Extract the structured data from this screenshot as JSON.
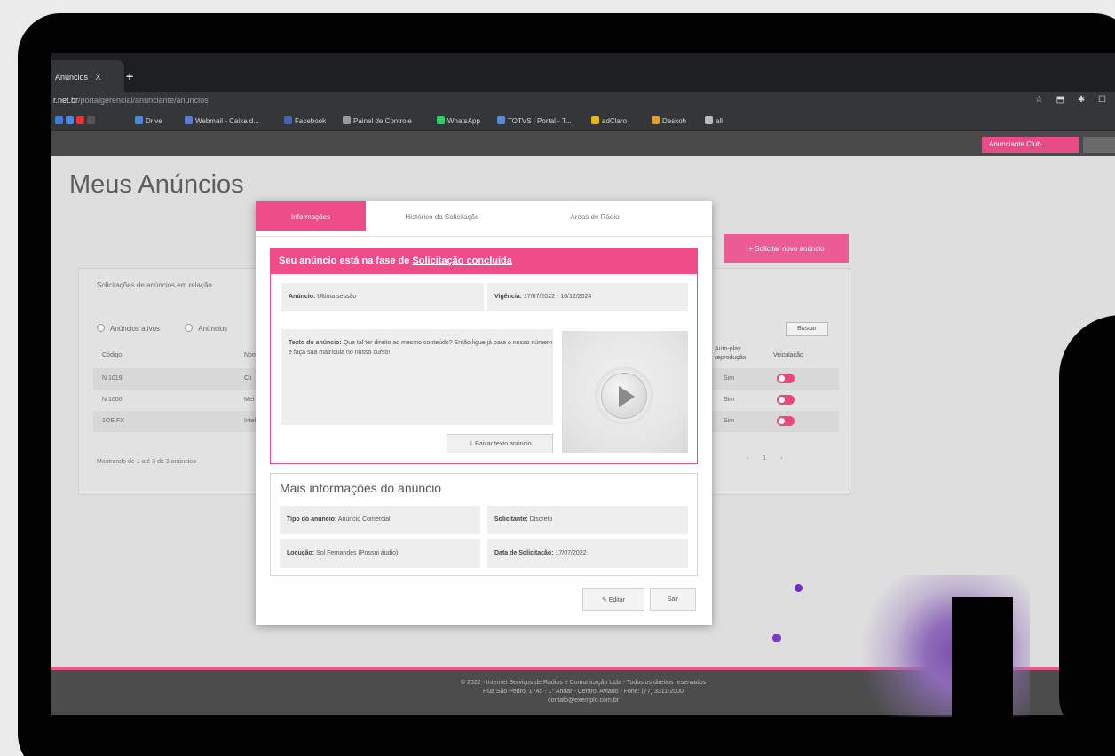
{
  "browser": {
    "tab_title": "Anúncios",
    "tab_close": "X",
    "new_tab": "+",
    "url_domain": "r.net.br",
    "url_path": "/portalgerencial/anunciante/anuncios",
    "url_actions": "☆ ⬒ ✱ ☐",
    "bookmarks": [
      {
        "label": "Drive",
        "color": "#4a88e8"
      },
      {
        "label": "Webmail - Caixa d...",
        "color": "#5b7bd6"
      },
      {
        "label": "Facebook",
        "color": "#4267b2"
      },
      {
        "label": "Painel de Controle",
        "color": "#999999"
      },
      {
        "label": "WhatsApp",
        "color": "#25d366"
      },
      {
        "label": "TOTVS | Portal - T...",
        "color": "#5a8ad6"
      },
      {
        "label": "adClaro",
        "color": "#e6b800"
      },
      {
        "label": "Deskoh",
        "color": "#e6a020"
      },
      {
        "label": "all",
        "color": "#bbbbbb"
      }
    ]
  },
  "site": {
    "header_button": "Anunciante Club",
    "page_title": "Meus Anúncios",
    "new_ad_button": "+ Solicitar novo anúncio",
    "panel_title": "Solicitações de anúncios em relação",
    "radio_active": "Anúncios ativos",
    "radio_other": "Anúncios",
    "filter_button": "Buscar",
    "col_code": "Código",
    "col_name": "Nome",
    "col_autoplay": "Auto-play reprodução",
    "col_toggle": "Veiculação",
    "rows": [
      {
        "code": "N 1019",
        "name": "Cli",
        "flag": "Sim"
      },
      {
        "code": "N 1000",
        "name": "Mei Locat",
        "flag": "Sim"
      },
      {
        "code": "1OE FX",
        "name": "Intel",
        "flag": "Sim"
      }
    ],
    "panel_footer": "Mostrando de 1 até 3 de 3 anúncios",
    "pager": "‹ 1 ›",
    "footer_line1": "© 2022 - Internet Serviços de Rádios e Comunicação Ltda - Todos os direitos reservados",
    "footer_line2": "Rua São Pedro, 1745 - 1° Andar - Centro, Aviado - Fone: (77) 3311-2000",
    "footer_line3": "contato@exemplo.com.br"
  },
  "modal": {
    "tabs": [
      "Informações",
      "Histórico da Solicitação",
      "Áreas de Rádio"
    ],
    "banner_prefix": "Seu anúncio está na fase de",
    "banner_status": "Solicitação concluída",
    "advertiser_label": "Anúncio:",
    "advertiser_value": "Ultima sessão",
    "validity_label": "Vigência:",
    "validity_value": "17/07/2022 - 16/12/2024",
    "ad_text_label": "Texto do anúncio:",
    "ad_text_value": "Que tal ter direito ao mesmo conteúdo? Então ligue já para o nosso número e faça sua matrícula no nosso curso!",
    "download_button": "⇩ Baixar texto anúncio",
    "more_title": "Mais informações do anúncio",
    "type_label": "Tipo do anúncio:",
    "type_value": "Anúncio Comercial",
    "requester_label": "Solicitante:",
    "requester_value": "Discreto",
    "location_label": "Locução:",
    "location_value": "Sol Fernandes (Possui áudio)",
    "date_label": "Data de Solicitação:",
    "date_value": "17/07/2022",
    "edit_button": "✎ Editar",
    "close_button": "Sair"
  }
}
